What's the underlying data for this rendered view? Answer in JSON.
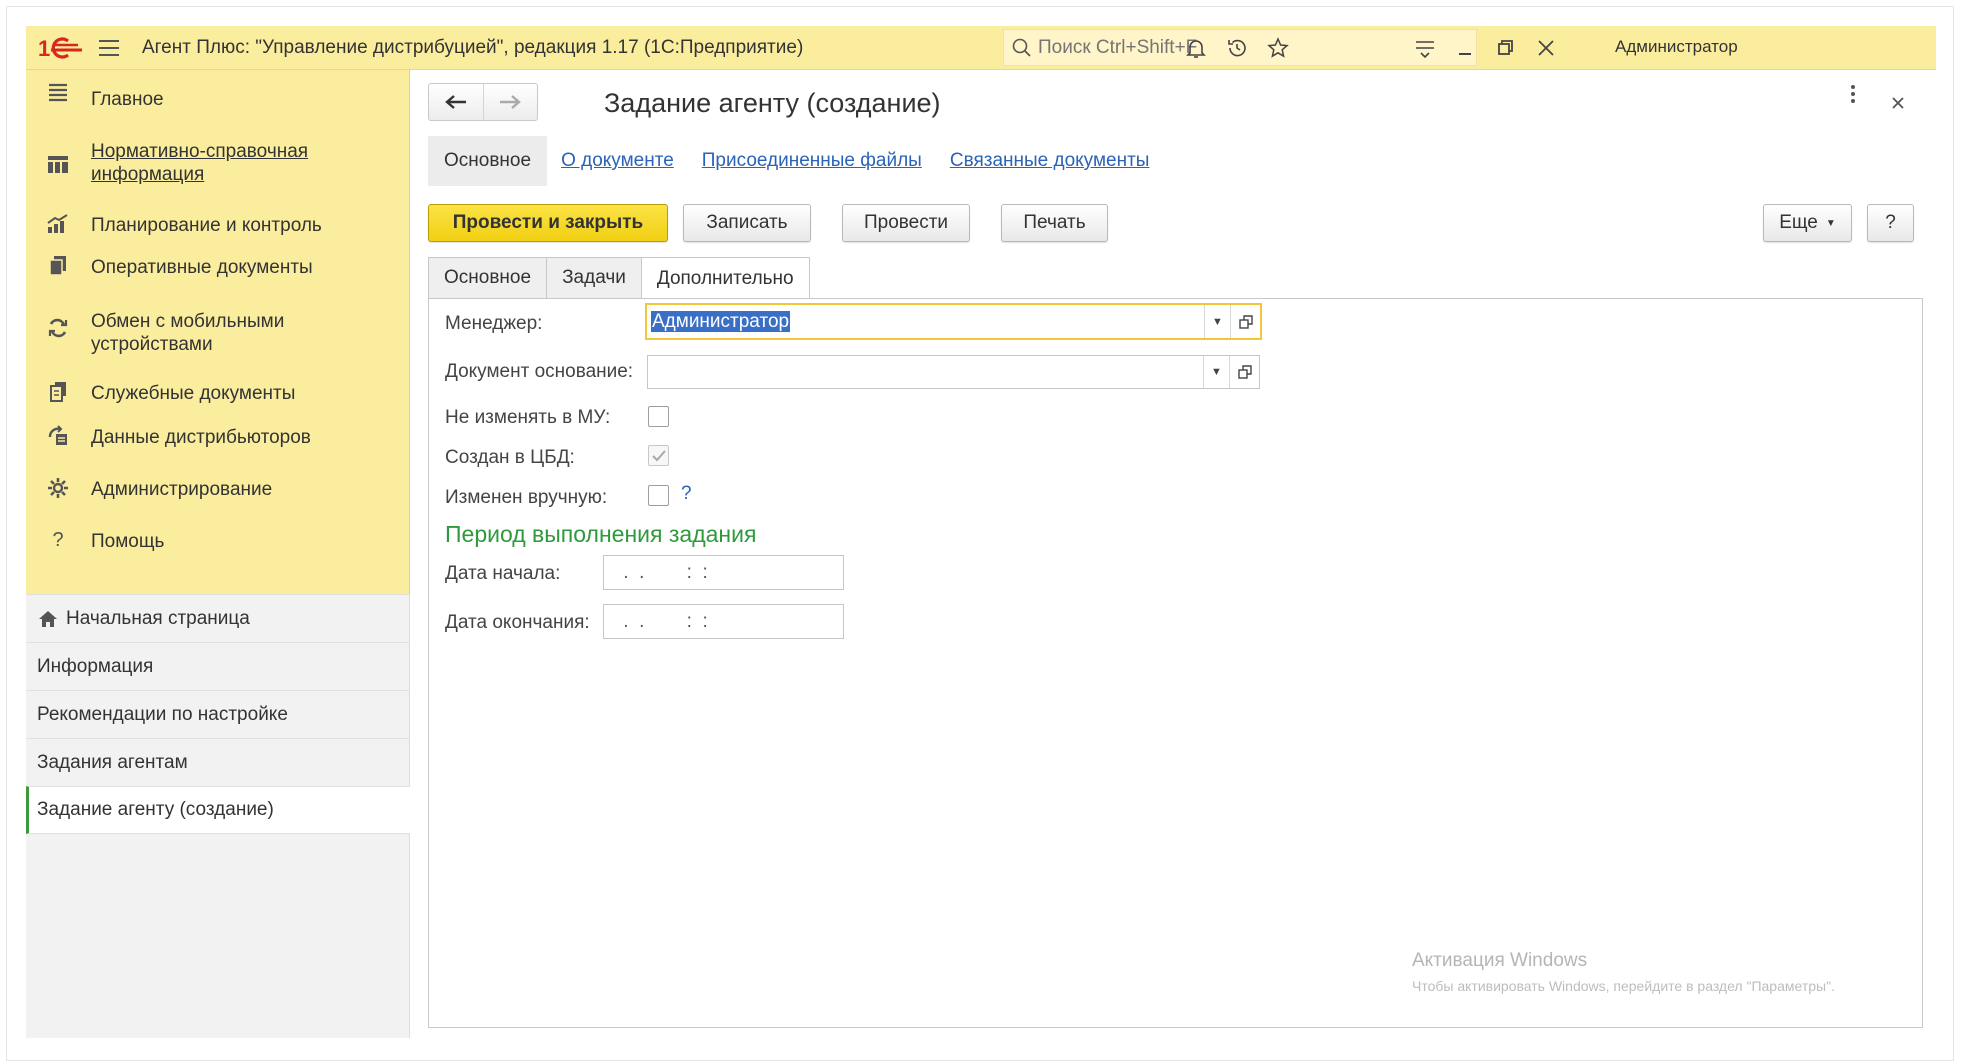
{
  "app": {
    "title": "Агент Плюс: \"Управление дистрибуцией\", редакция 1.17  (1С:Предприятие)",
    "search_placeholder": "Поиск Ctrl+Shift+F",
    "user": "Администратор"
  },
  "sidebar": {
    "items": [
      {
        "label": "Главное",
        "icon": "hamburger-icon"
      },
      {
        "label": "Нормативно-справочная информация",
        "icon": "catalog-icon"
      },
      {
        "label": "Планирование и контроль",
        "icon": "chart-icon"
      },
      {
        "label": "Оперативные документы",
        "icon": "documents-icon"
      },
      {
        "label": "Обмен с мобильными устройствами",
        "icon": "sync-icon"
      },
      {
        "label": "Служебные документы",
        "icon": "service-docs-icon"
      },
      {
        "label": "Данные дистрибьюторов",
        "icon": "distributor-data-icon"
      },
      {
        "label": "Администрирование",
        "icon": "gear-icon"
      },
      {
        "label": "Помощь",
        "icon": "help-icon"
      }
    ],
    "open_windows": [
      {
        "label": "Начальная страница"
      },
      {
        "label": "Информация"
      },
      {
        "label": "Рекомендации по настройке"
      },
      {
        "label": "Задания агентам"
      },
      {
        "label": "Задание агенту (создание)"
      }
    ]
  },
  "document": {
    "title": "Задание агенту (создание)",
    "section_tabs": [
      "Основное",
      "О документе",
      "Присоединенные файлы",
      "Связанные документы"
    ],
    "buttons": {
      "post_close": "Провести и закрыть",
      "save": "Записать",
      "post": "Провести",
      "print": "Печать",
      "more": "Еще",
      "help": "?"
    },
    "tabs": [
      "Основное",
      "Задачи",
      "Дополнительно"
    ],
    "active_tab": "Дополнительно",
    "fields": {
      "manager_label": "Менеджер:",
      "manager_value": "Администратор",
      "base_doc_label": "Документ основание:",
      "base_doc_value": "",
      "no_change_mu_label": "Не изменять в МУ:",
      "no_change_mu_checked": false,
      "created_cbd_label": "Создан в ЦБД:",
      "created_cbd_checked": true,
      "changed_manually_label": "Изменен вручную:",
      "changed_manually_checked": false,
      "help_q": "?"
    },
    "period": {
      "title": "Период выполнения задания",
      "start_label": "Дата начала:",
      "start_value": " .  .        :  :",
      "end_label": "Дата окончания:",
      "end_value": " .  .        :  :"
    }
  },
  "watermark": {
    "line1": "Активация Windows",
    "line2": "Чтобы активировать Windows, перейдите в раздел \"Параметры\"."
  },
  "colors": {
    "titlebar": "#fbed9e",
    "primary_button": "#f1cf13",
    "link": "#2a63b7",
    "group_title": "#2e9a3c"
  }
}
